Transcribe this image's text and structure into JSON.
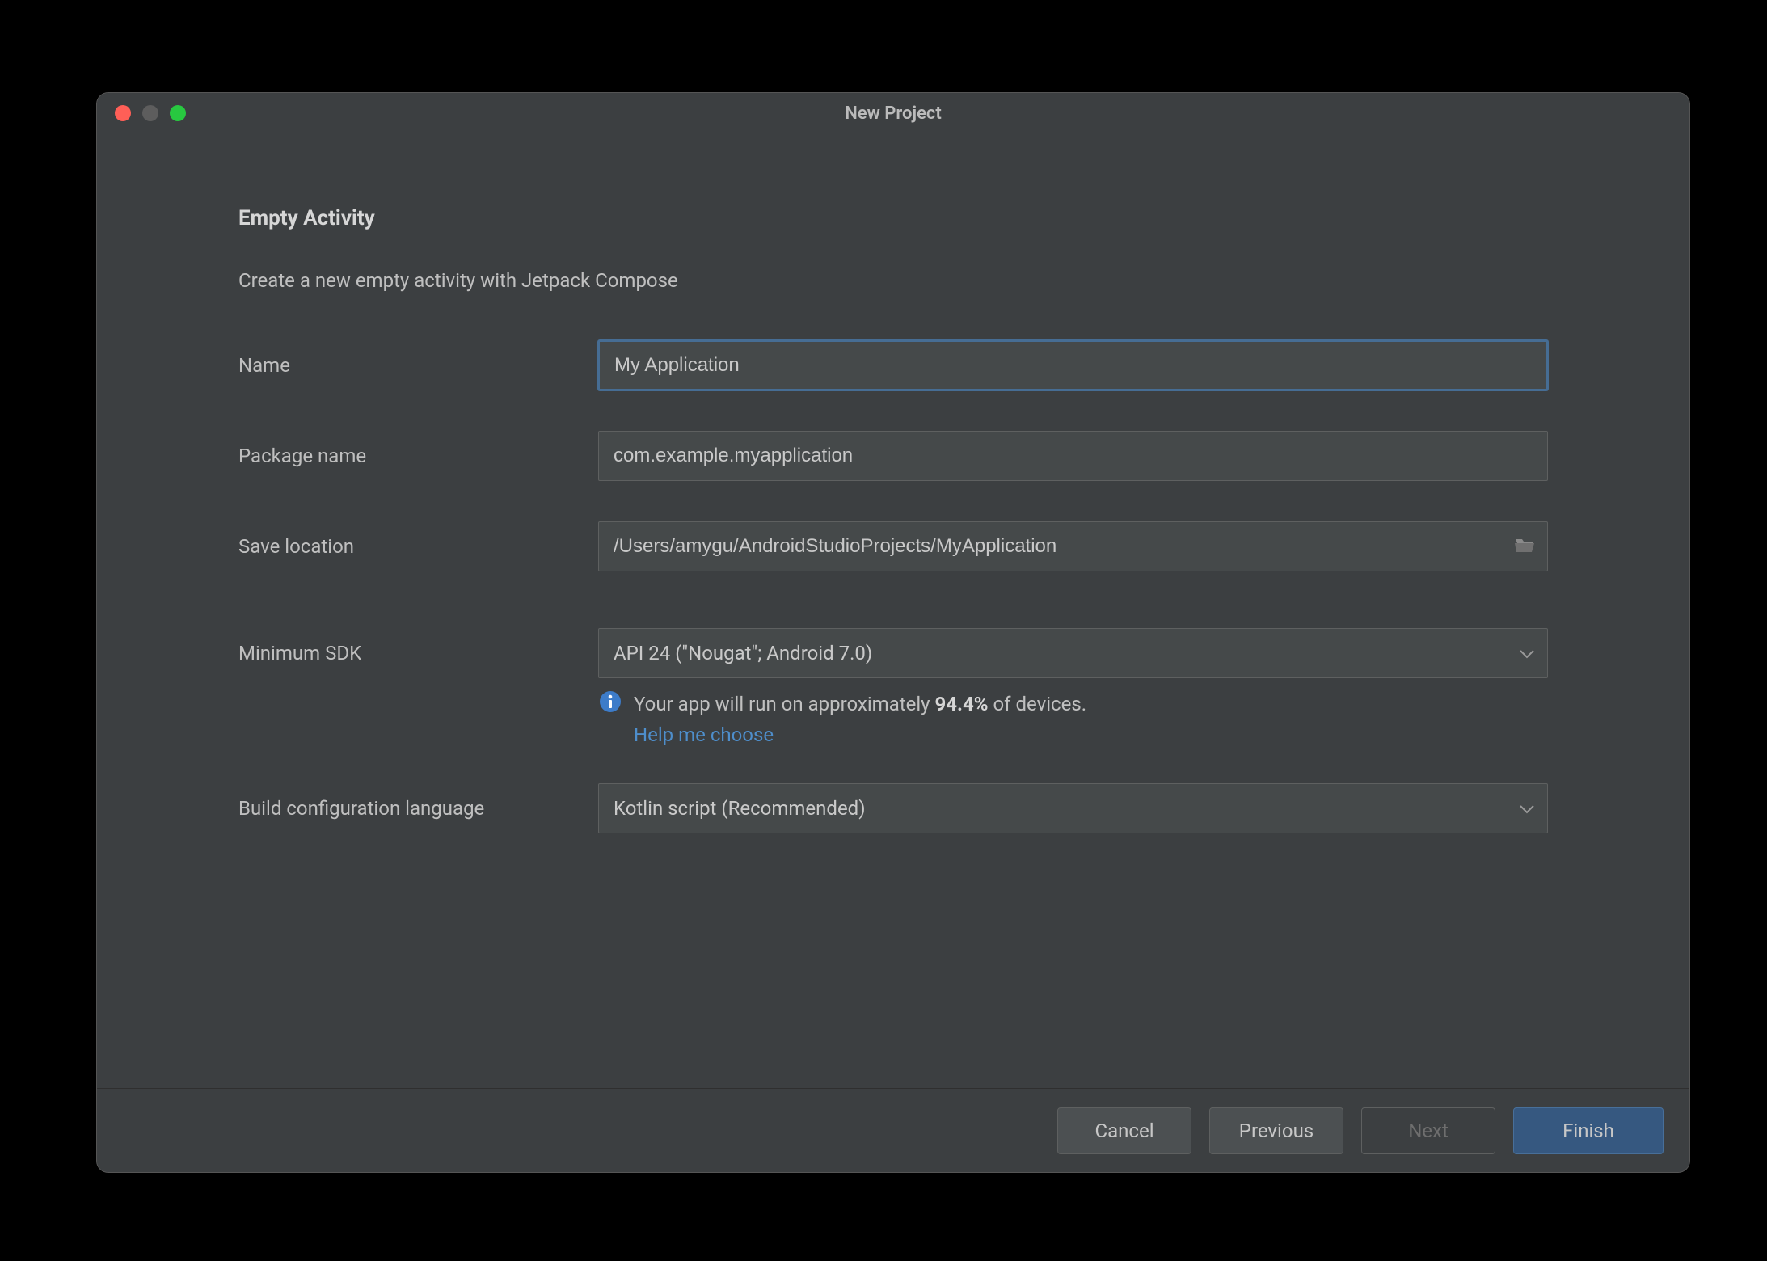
{
  "window": {
    "title": "New Project"
  },
  "page": {
    "heading": "Empty Activity",
    "description": "Create a new empty activity with Jetpack Compose"
  },
  "form": {
    "name_label": "Name",
    "name_value": "My Application",
    "package_label": "Package name",
    "package_value": "com.example.myapplication",
    "location_label": "Save location",
    "location_value": "/Users/amygu/AndroidStudioProjects/MyApplication",
    "min_sdk_label": "Minimum SDK",
    "min_sdk_value": "API 24 (\"Nougat\"; Android 7.0)",
    "hint_prefix": "Your app will run on approximately ",
    "hint_percent": "94.4%",
    "hint_suffix": " of devices.",
    "help_link": "Help me choose",
    "build_lang_label": "Build configuration language",
    "build_lang_value": "Kotlin script (Recommended)"
  },
  "footer": {
    "cancel": "Cancel",
    "previous": "Previous",
    "next": "Next",
    "finish": "Finish"
  }
}
